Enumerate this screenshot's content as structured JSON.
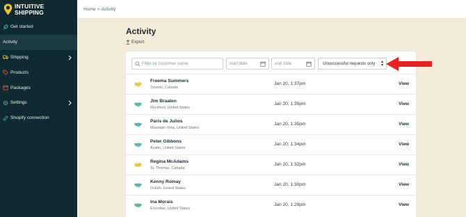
{
  "logo": {
    "line1": "INTUITIVE",
    "line2": "SHIPPING"
  },
  "sidebar": {
    "items": [
      {
        "label": "Get started",
        "icon": "rocket-icon",
        "has_submenu": false,
        "active": false
      },
      {
        "label": "Activity",
        "icon": "",
        "has_submenu": false,
        "active": true
      },
      {
        "label": "Shipping",
        "icon": "truck-icon",
        "has_submenu": true,
        "active": false
      },
      {
        "label": "Products",
        "icon": "tag-icon",
        "has_submenu": false,
        "active": false
      },
      {
        "label": "Packages",
        "icon": "package-icon",
        "has_submenu": false,
        "active": false
      },
      {
        "label": "Settings",
        "icon": "gear-icon",
        "has_submenu": true,
        "active": false
      },
      {
        "label": "Shopify connection",
        "icon": "link-icon",
        "has_submenu": false,
        "active": false
      }
    ]
  },
  "breadcrumb": {
    "home": "Home",
    "separator": ">",
    "current": "Activity"
  },
  "page": {
    "title": "Activity",
    "export_label": "Export"
  },
  "filters": {
    "search_placeholder": "Filter by customer name",
    "start_date_placeholder": "start date",
    "end_date_placeholder": "end date",
    "requests_filter_value": "Unsuccessful requests only"
  },
  "rows": [
    {
      "name": "Freema Summers",
      "location": "Toronto, Canada",
      "date": "Jan 20, 1:37pm",
      "action": "View",
      "flag": "canada-flag-icon"
    },
    {
      "name": "Jim Braaten",
      "location": "Rockford, United States",
      "date": "Jan 20, 1:35pm",
      "action": "View",
      "flag": "usa-flag-icon"
    },
    {
      "name": "Paris de Julios",
      "location": "Mountain View, United States",
      "date": "Jan 20, 1:35pm",
      "action": "View",
      "flag": "usa-flag-icon"
    },
    {
      "name": "Peter Gibbons",
      "location": "Austin, United States",
      "date": "Jan 20, 1:34pm",
      "action": "View",
      "flag": "usa-flag-icon"
    },
    {
      "name": "Regina McAdams",
      "location": "St. Thomas, Canada",
      "date": "Jan 20, 1:32pm",
      "action": "View",
      "flag": "canada-flag-icon"
    },
    {
      "name": "Kenny Romay",
      "location": "Duluth, United States",
      "date": "Jan 20, 1:30pm",
      "action": "View",
      "flag": "usa-flag-icon"
    },
    {
      "name": "Ina Morais",
      "location": "Encinitas, United States",
      "date": "Jan 20, 1:29pm",
      "action": "View",
      "flag": "usa-flag-icon"
    }
  ],
  "colors": {
    "sidebar_bg": "#0f2a30",
    "sidebar_active": "#1d3a41",
    "brand_yellow": "#f2c230",
    "page_bg": "#f3ead8",
    "annotation_red": "#e8201f",
    "usa_map": "#5fb5a8",
    "canada_map": "#eec43a"
  }
}
